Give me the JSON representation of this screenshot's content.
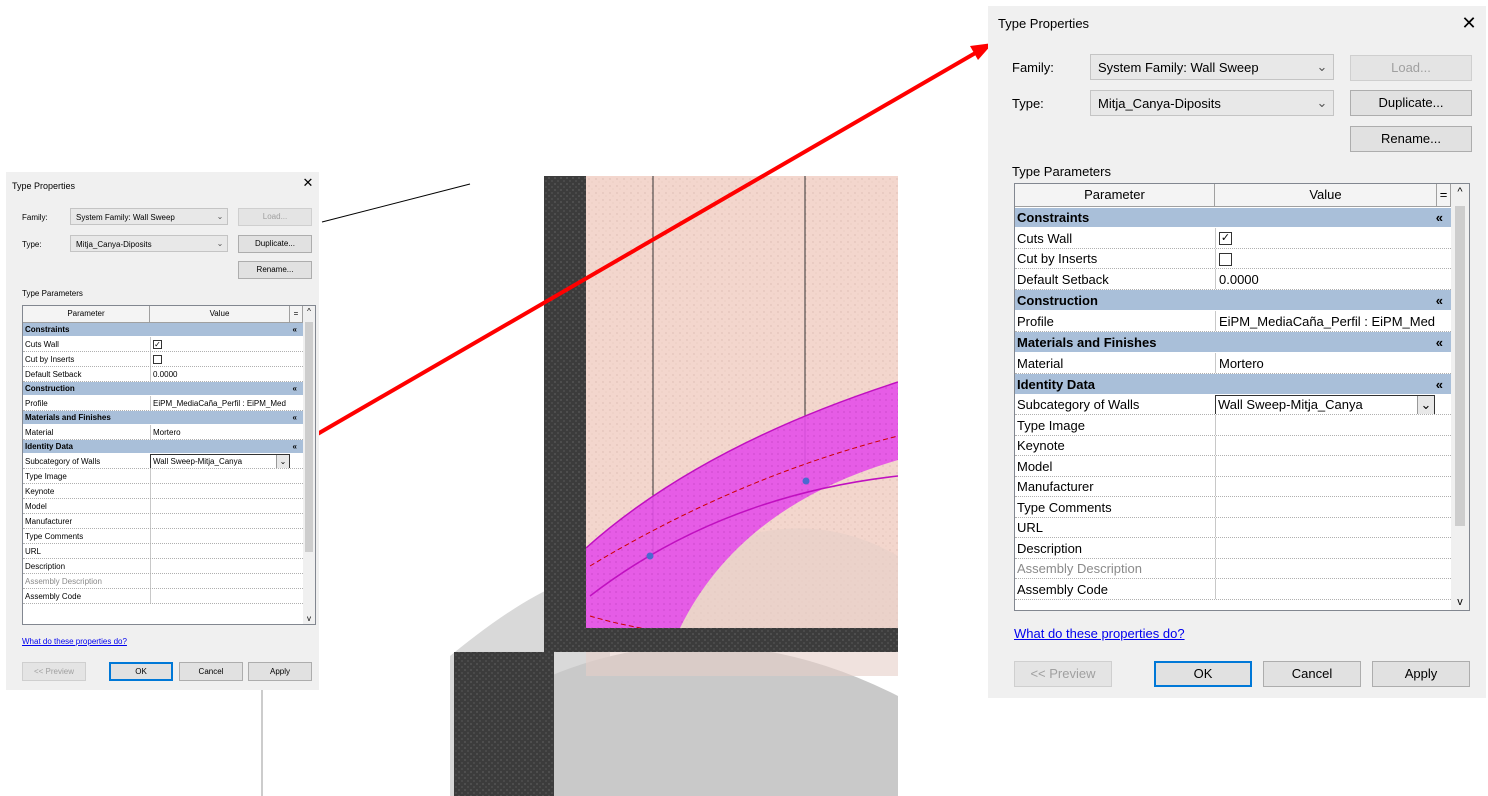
{
  "small": {
    "title": "Type Properties",
    "family_label": "Family:",
    "family_value": "System Family: Wall Sweep",
    "type_label": "Type:",
    "type_value": "Mitja_Canya-Diposits",
    "load": "Load...",
    "duplicate": "Duplicate...",
    "rename": "Rename...",
    "type_params": "Type Parameters",
    "col_param": "Parameter",
    "col_value": "Value",
    "link": "What do these properties do?",
    "preview": "<< Preview",
    "ok": "OK",
    "cancel": "Cancel",
    "apply": "Apply"
  },
  "large": {
    "title": "Type Properties",
    "family_label": "Family:",
    "family_value": "System Family: Wall Sweep",
    "type_label": "Type:",
    "type_value": "Mitja_Canya-Diposits",
    "load": "Load...",
    "duplicate": "Duplicate...",
    "rename": "Rename...",
    "type_params": "Type Parameters",
    "col_param": "Parameter",
    "col_value": "Value",
    "link": "What do these properties do?",
    "preview": "<< Preview",
    "ok": "OK",
    "cancel": "Cancel",
    "apply": "Apply"
  },
  "params": {
    "g_constraints": "Constraints",
    "cuts_wall": "Cuts Wall",
    "cut_by_inserts": "Cut by Inserts",
    "default_setback": "Default Setback",
    "default_setback_value": "0.0000",
    "g_construction": "Construction",
    "profile": "Profile",
    "profile_value": "EiPM_MediaCaña_Perfil : EiPM_Med",
    "g_materials": "Materials and Finishes",
    "material": "Material",
    "material_value": "Mortero",
    "g_identity": "Identity Data",
    "subcategory": "Subcategory of Walls",
    "subcategory_value": "Wall Sweep-Mitja_Canya",
    "type_image": "Type Image",
    "keynote": "Keynote",
    "model": "Model",
    "manufacturer": "Manufacturer",
    "type_comments": "Type Comments",
    "url": "URL",
    "description": "Description",
    "assembly_description": "Assembly Description",
    "assembly_code": "Assembly Code"
  },
  "state": {
    "cuts_wall_checked": true,
    "cut_by_inserts_checked": false
  },
  "icons": {
    "close": "close-icon",
    "dropdown": "chevron-down-icon",
    "collapse": "double-chevron-up-icon",
    "checkmark": "checkmark-icon",
    "scroll_up": "scroll-up-icon",
    "scroll_down": "scroll-down-icon"
  },
  "colors": {
    "group_header": "#a9bfd9",
    "callout_arrow": "#ff0000",
    "sweep_magenta": "#e23ee8",
    "wall_fill": "#f2d1c8",
    "wall_dark": "#3a3a3a",
    "link": "#0000ee"
  }
}
